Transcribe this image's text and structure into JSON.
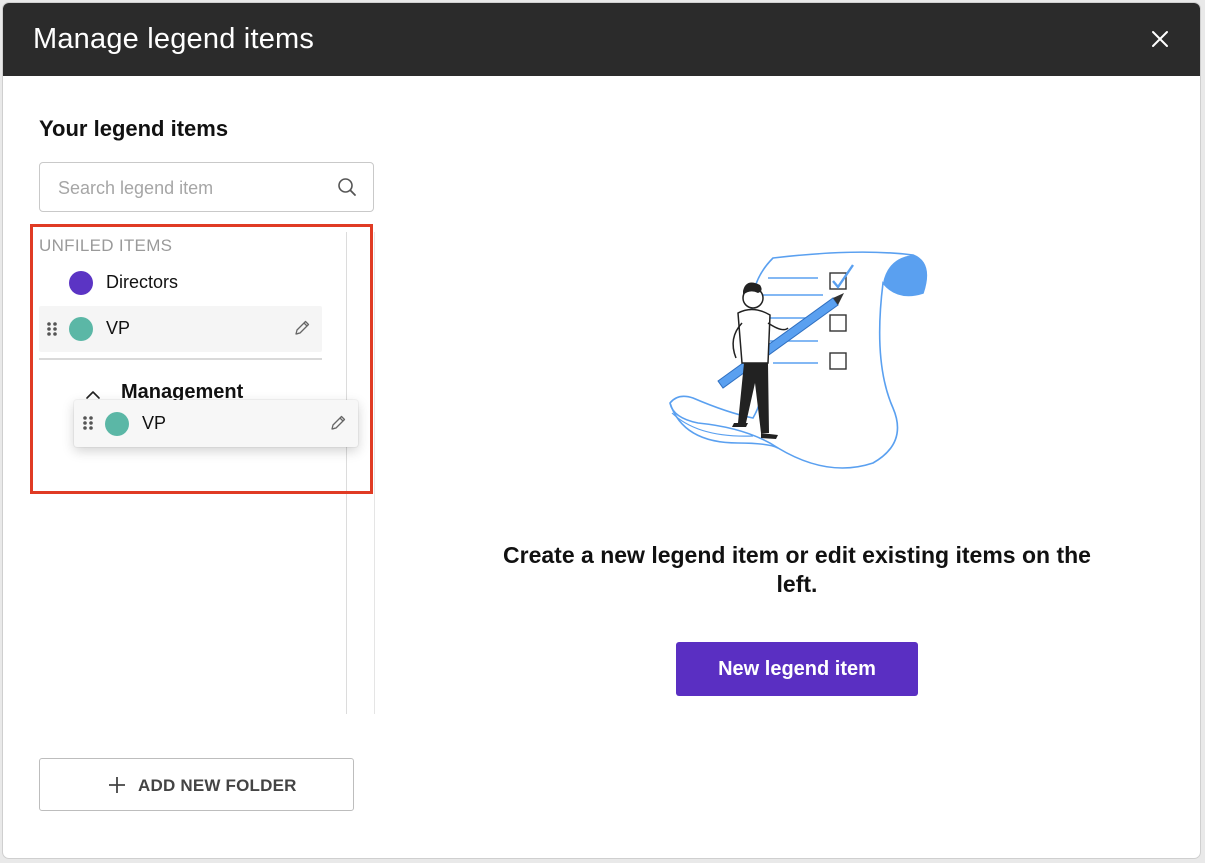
{
  "modal": {
    "title": "Manage legend items"
  },
  "left": {
    "title": "Your legend items",
    "search": {
      "placeholder": "Search legend item",
      "value": ""
    },
    "unfiled_label": "UNFILED ITEMS",
    "unfiled_items": [
      {
        "label": "Directors",
        "color": "#5b34c4"
      },
      {
        "label": "VP",
        "color": "#5bb7a6"
      }
    ],
    "folders": [
      {
        "name": "Management",
        "expanded": true
      }
    ],
    "dragging_item": {
      "label": "VP",
      "color": "#5bb7a6"
    },
    "add_folder_label": "ADD NEW FOLDER"
  },
  "right": {
    "empty_message": "Create a new legend item or edit existing items on the left.",
    "new_button_label": "New legend item"
  },
  "colors": {
    "header_bg": "#2b2b2b",
    "primary": "#5a2fc2",
    "highlight": "#e03b24",
    "illustration_blue": "#5aa0f0"
  }
}
